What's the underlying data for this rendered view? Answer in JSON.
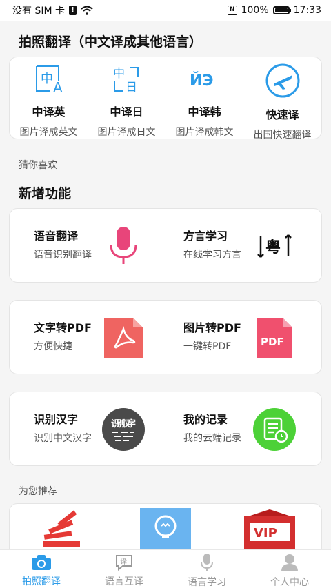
{
  "status_bar": {
    "carrier": "没有 SIM 卡",
    "battery": "100%",
    "time": "17:33"
  },
  "photo_translate": {
    "title": "拍照翻译（中文译成其他语言）",
    "items": [
      {
        "name": "中译英",
        "desc": "图片译成英文",
        "icon": "zh-en-icon"
      },
      {
        "name": "中译日",
        "desc": "图片译成日文",
        "icon": "zh-ja-icon"
      },
      {
        "name": "中译韩",
        "desc": "图片译成韩文",
        "icon": "zh-ko-icon"
      },
      {
        "name": "快速译",
        "desc": "出国快速翻译",
        "icon": "airplane-icon"
      }
    ]
  },
  "guess_label": "猜你喜欢",
  "new_features": {
    "title": "新增功能",
    "rows": [
      [
        {
          "name": "语音翻译",
          "desc": "语音识别翻译",
          "icon": "microphone-icon"
        },
        {
          "name": "方言学习",
          "desc": "在线学习方言",
          "icon": "cantonese-icon"
        }
      ],
      [
        {
          "name": "文字转PDF",
          "desc": "方便快捷",
          "icon": "pdf-acrobat-icon"
        },
        {
          "name": "图片转PDF",
          "desc": "一键转PDF",
          "icon": "pdf-file-icon"
        }
      ],
      [
        {
          "name": "识别汉字",
          "desc": "识别中文汉字",
          "icon": "chinese-characters-icon"
        },
        {
          "name": "我的记录",
          "desc": "我的云端记录",
          "icon": "records-clock-icon"
        }
      ]
    ]
  },
  "recommend": {
    "label": "为您推荐",
    "items": [
      {
        "icon": "stack-app-icon"
      },
      {
        "icon": "lightbulb-app-icon"
      },
      {
        "icon": "vip-app-icon",
        "text": "VIP"
      }
    ]
  },
  "tabbar": {
    "tabs": [
      {
        "label": "拍照翻译",
        "icon": "camera-icon",
        "active": true
      },
      {
        "label": "语言互译",
        "icon": "chat-translate-icon",
        "active": false
      },
      {
        "label": "语言学习",
        "icon": "microphone-tab-icon",
        "active": false
      },
      {
        "label": "个人中心",
        "icon": "person-icon",
        "active": false
      }
    ]
  },
  "colors": {
    "accent": "#2b9be8",
    "mic": "#e8457a",
    "pdf_red": "#ef6461",
    "record_green": "#4cd137"
  },
  "icon_text": {
    "zh_en_char": "中",
    "zh_en_latin": "A",
    "zh_ja_top": "中",
    "zh_ja_bottom": "日",
    "zh_ko": "ЙЭ",
    "cantonese": "粤",
    "pdf": "PDF",
    "chars": "识别汉字",
    "translate_tab": "译"
  }
}
